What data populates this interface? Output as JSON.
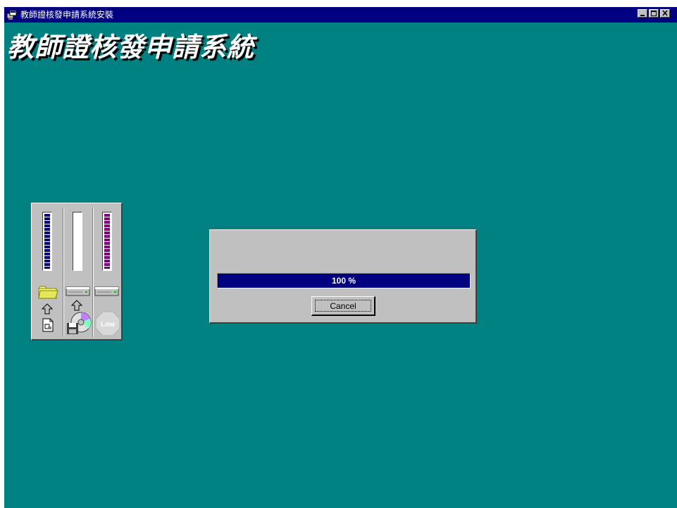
{
  "window": {
    "title": "教師證核發申請系統安裝",
    "background_color": "#008080",
    "titlebar_color": "#000080",
    "controls": [
      "minimize-icon",
      "maximize-icon",
      "close-icon"
    ]
  },
  "banner": {
    "text": "教師證核發申請系統"
  },
  "meters": [
    {
      "name": "source-meter",
      "level": 1.0,
      "color": "#000080",
      "icons": [
        "folder-icon",
        "up-arrow-icon",
        "document-icon"
      ]
    },
    {
      "name": "destination-meter",
      "level": 0.0,
      "color": "#000080",
      "icons": [
        "drive-icon",
        "up-arrow-icon",
        "disk-cd-icon"
      ]
    },
    {
      "name": "disk-space-meter",
      "level": 1.0,
      "color": "#800080",
      "icons": [
        "drive-icon",
        "low-stop-sign-icon"
      ]
    }
  ],
  "low_sign_label": "Low",
  "progress": {
    "percent": 100,
    "text": "100 %"
  },
  "cancel_button": {
    "label": "Cancel"
  }
}
